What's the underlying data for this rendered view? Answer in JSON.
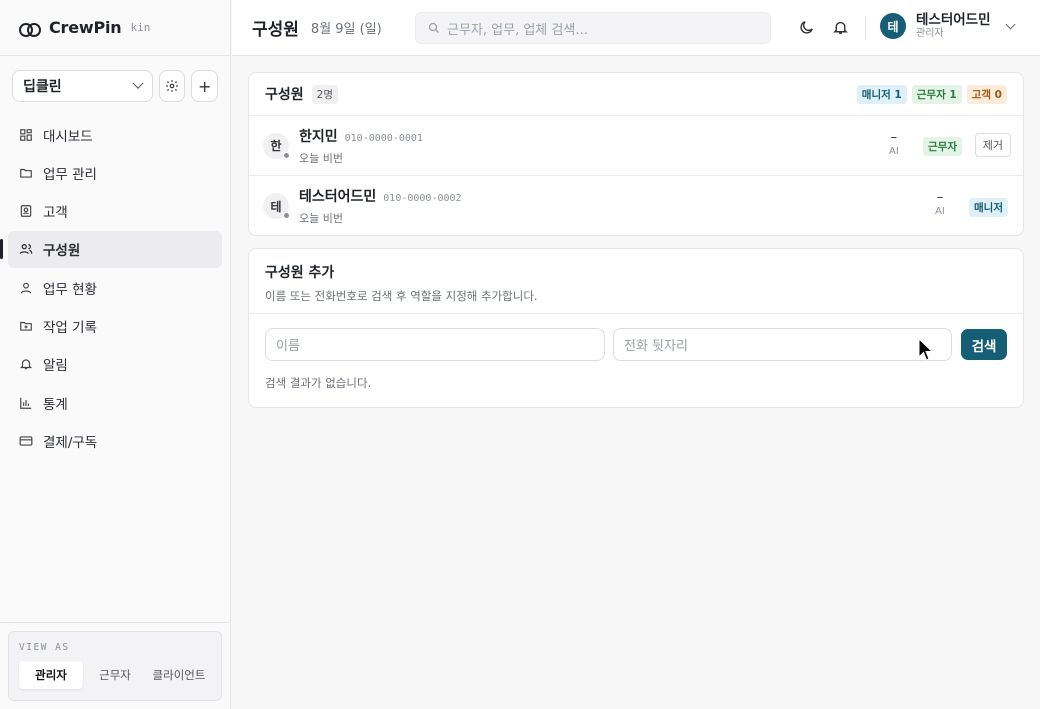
{
  "brand": {
    "name": "CrewPin",
    "sub": "kin"
  },
  "org": {
    "selected": "딥클린"
  },
  "sidebar": {
    "items": [
      {
        "label": "대시보드",
        "icon": "grid-icon"
      },
      {
        "label": "업무 관리",
        "icon": "folder-icon"
      },
      {
        "label": "고객",
        "icon": "contact-icon"
      },
      {
        "label": "구성원",
        "icon": "users-icon",
        "active": true
      },
      {
        "label": "업무 현황",
        "icon": "person-icon"
      },
      {
        "label": "작업 기록",
        "icon": "folder-plus-icon"
      },
      {
        "label": "알림",
        "icon": "bell-icon"
      },
      {
        "label": "통계",
        "icon": "bar-chart-icon"
      },
      {
        "label": "결제/구독",
        "icon": "card-icon"
      }
    ]
  },
  "view_as": {
    "title": "VIEW AS",
    "options": [
      "관리자",
      "근무자",
      "클라이언트"
    ],
    "selected": "관리자"
  },
  "header": {
    "title": "구성원",
    "date": "8월 9일 (일)",
    "search_placeholder": "근무자, 업무, 업체 검색…"
  },
  "user": {
    "initial": "테",
    "name": "테스터어드민",
    "role": "관리자"
  },
  "members_card": {
    "title": "구성원",
    "count": "2명",
    "badges": {
      "manager": "매니저 1",
      "worker": "근무자 1",
      "client": "고객 0"
    },
    "members": [
      {
        "initial": "한",
        "name": "한지민",
        "phone": "010-0000-0001",
        "sub": "오늘 비번",
        "ai_dash": "–",
        "ai": "AI",
        "role": "근무자",
        "remove": "제거"
      },
      {
        "initial": "테",
        "name": "테스터어드민",
        "phone": "010-0000-0002",
        "sub": "오늘 비번",
        "ai_dash": "–",
        "ai": "AI",
        "role": "매니저"
      }
    ]
  },
  "add_card": {
    "title": "구성원 추가",
    "desc": "이름 또는 전화번호로 검색 후 역할을 지정해 추가합니다.",
    "name_placeholder": "이름",
    "phone_placeholder": "전화 뒷자리",
    "search_label": "검색",
    "empty": "검색 결과가 없습니다."
  },
  "colors": {
    "accent": "#155e75",
    "manager_bg": "#dff1f7",
    "worker_bg": "#e3f4e6",
    "client_bg": "#fbecd9"
  }
}
